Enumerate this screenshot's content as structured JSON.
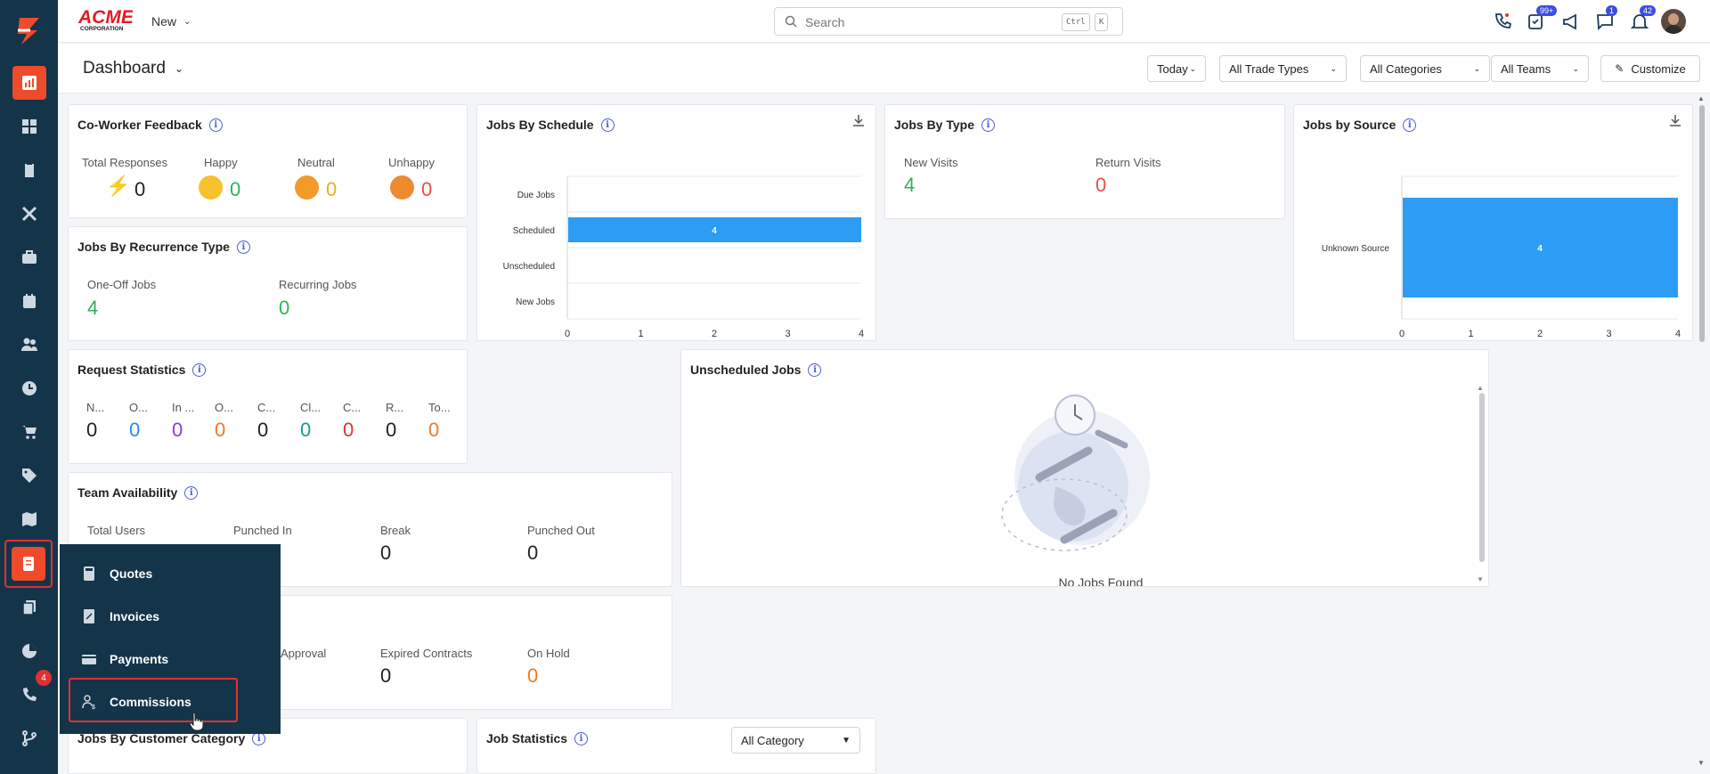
{
  "app": {
    "brand": "ACME CORPORATION",
    "new_label": "New",
    "search_placeholder": "Search",
    "kbd_ctrl": "Ctrl",
    "kbd_k": "K"
  },
  "badges": {
    "phone": "",
    "tasks": "99+",
    "chat": "1",
    "notifications": "42",
    "sidebar_calls": "4"
  },
  "dashboard": {
    "title": "Dashboard"
  },
  "filters": {
    "date": "Today",
    "trade": "All Trade Types",
    "categories": "All Categories",
    "teams": "All Teams",
    "customize": "Customize"
  },
  "feedback": {
    "title": "Co-Worker Feedback",
    "total_label": "Total Responses",
    "total": "0",
    "happy_label": "Happy",
    "happy": "0",
    "neutral_label": "Neutral",
    "neutral": "0",
    "unhappy_label": "Unhappy",
    "unhappy": "0"
  },
  "recurrence": {
    "title": "Jobs By Recurrence Type",
    "one_off_label": "One-Off Jobs",
    "one_off": "4",
    "recurring_label": "Recurring Jobs",
    "recurring": "0"
  },
  "request_stats": {
    "title": "Request Statistics",
    "items": [
      {
        "label": "N...",
        "value": "0"
      },
      {
        "label": "O...",
        "value": "0"
      },
      {
        "label": "In ...",
        "value": "0"
      },
      {
        "label": "O...",
        "value": "0"
      },
      {
        "label": "C...",
        "value": "0"
      },
      {
        "label": "Cl...",
        "value": "0"
      },
      {
        "label": "C...",
        "value": "0"
      },
      {
        "label": "R...",
        "value": "0"
      },
      {
        "label": "To...",
        "value": "0"
      }
    ]
  },
  "team": {
    "title": "Team Availability",
    "total_label": "Total Users",
    "punched_in_label": "Punched In",
    "break_label": "Break",
    "break": "0",
    "punched_out_label": "Punched Out",
    "punched_out": "0"
  },
  "contracts": {
    "approval_label": "Approval",
    "expired_label": "Expired Contracts",
    "expired": "0",
    "hold_label": "On Hold",
    "hold": "0"
  },
  "schedule": {
    "title": "Jobs By Schedule"
  },
  "bytype": {
    "title": "Jobs By Type",
    "new_label": "New Visits",
    "new": "4",
    "return_label": "Return Visits",
    "return": "0"
  },
  "source": {
    "title": "Jobs by Source"
  },
  "unscheduled": {
    "title": "Unscheduled Jobs",
    "empty": "No Jobs Found"
  },
  "customer_cat": {
    "title": "Jobs By Customer Category"
  },
  "job_stats": {
    "title": "Job Statistics",
    "select": "All Category"
  },
  "menu": {
    "quotes": "Quotes",
    "invoices": "Invoices",
    "payments": "Payments",
    "commissions": "Commissions"
  },
  "chart_data": [
    {
      "type": "bar",
      "orientation": "horizontal",
      "categories": [
        "Due Jobs",
        "Scheduled",
        "Unscheduled",
        "New Jobs"
      ],
      "values": [
        0,
        4,
        0,
        0
      ],
      "data_labels": [
        "",
        "4",
        "",
        ""
      ],
      "xticks": [
        "0",
        "1",
        "2",
        "3",
        "4"
      ],
      "xlim": [
        0,
        4
      ],
      "color": "#2d9cf5"
    },
    {
      "type": "bar",
      "orientation": "horizontal",
      "categories": [
        "Unknown Source"
      ],
      "values": [
        4
      ],
      "data_labels": [
        "4"
      ],
      "xticks": [
        "0",
        "1",
        "2",
        "3",
        "4"
      ],
      "xlim": [
        0,
        4
      ],
      "color": "#2d9cf5"
    }
  ]
}
